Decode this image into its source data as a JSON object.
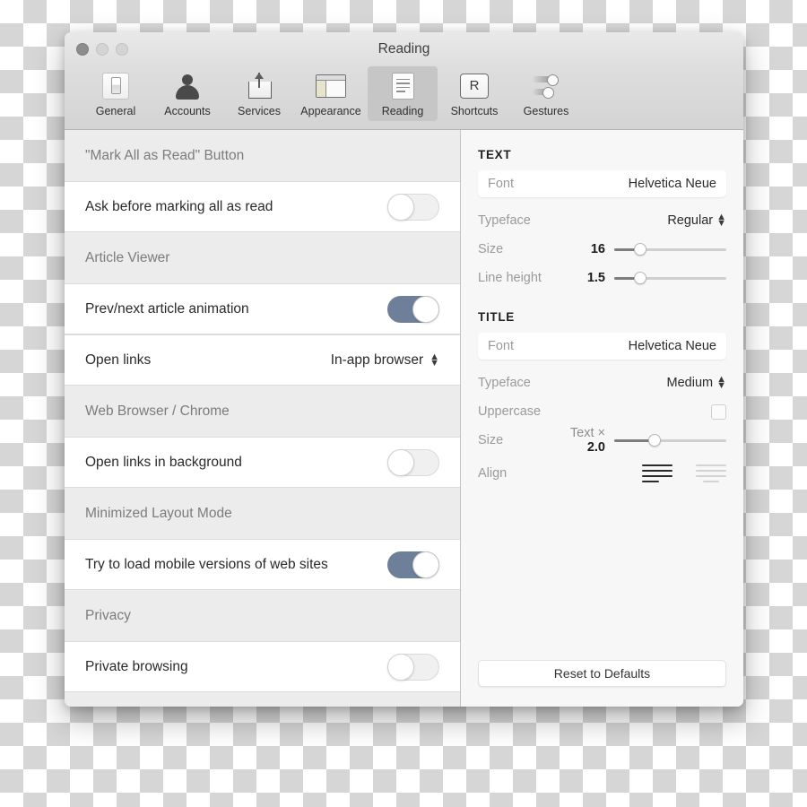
{
  "window": {
    "title": "Reading",
    "traffic_lights": [
      "close",
      "minimize",
      "zoom"
    ]
  },
  "toolbar": {
    "items": [
      {
        "label": "General",
        "icon": "switch-icon",
        "selected": false
      },
      {
        "label": "Accounts",
        "icon": "person-icon",
        "selected": false
      },
      {
        "label": "Services",
        "icon": "share-icon",
        "selected": false
      },
      {
        "label": "Appearance",
        "icon": "layout-icon",
        "selected": false
      },
      {
        "label": "Reading",
        "icon": "document-icon",
        "selected": true
      },
      {
        "label": "Shortcuts",
        "icon": "key-r-icon",
        "selected": false
      },
      {
        "label": "Gestures",
        "icon": "sliders-icon",
        "selected": false
      }
    ],
    "shortcut_key": "R"
  },
  "left_pane": {
    "groups": [
      {
        "heading": "\"Mark All as Read\" Button",
        "rows": [
          {
            "label": "Ask before marking all as read",
            "control": "toggle",
            "state": "off"
          }
        ]
      },
      {
        "heading": "Article Viewer",
        "rows": [
          {
            "label": "Prev/next article animation",
            "control": "toggle",
            "state": "on"
          },
          {
            "label": "Open links",
            "control": "popup",
            "value": "In-app browser"
          }
        ]
      },
      {
        "heading": "Web Browser / Chrome",
        "rows": [
          {
            "label": "Open links in background",
            "control": "toggle",
            "state": "off"
          }
        ]
      },
      {
        "heading": "Minimized Layout Mode",
        "rows": [
          {
            "label": "Try to load mobile versions of web sites",
            "control": "toggle",
            "state": "on"
          }
        ]
      },
      {
        "heading": "Privacy",
        "rows": [
          {
            "label": "Private browsing",
            "control": "toggle",
            "state": "off"
          }
        ]
      }
    ]
  },
  "right_pane": {
    "text_section": {
      "title": "TEXT",
      "font_label": "Font",
      "font_value": "Helvetica Neue",
      "typeface_label": "Typeface",
      "typeface_value": "Regular",
      "size_label": "Size",
      "size_value": "16",
      "size_percent": 23,
      "line_height_label": "Line height",
      "line_height_value": "1.5",
      "line_height_percent": 23
    },
    "title_section": {
      "title": "TITLE",
      "font_label": "Font",
      "font_value": "Helvetica Neue",
      "typeface_label": "Typeface",
      "typeface_value": "Medium",
      "uppercase_label": "Uppercase",
      "uppercase_checked": false,
      "size_label": "Size",
      "size_prefix": "Text ×",
      "size_value": "2.0",
      "size_percent": 36,
      "align_label": "Align",
      "align_selected": "left",
      "align_options": [
        "left",
        "center"
      ]
    },
    "reset_label": "Reset to Defaults"
  },
  "colors": {
    "toggle_on": "#6e7f99",
    "window_bg": "#ececec",
    "right_pane_bg": "#f7f7f7",
    "row_bg": "#ffffff",
    "heading_text": "#7c7c7c",
    "label_text": "#2a2a2a",
    "muted_text": "#9a9a9a"
  }
}
